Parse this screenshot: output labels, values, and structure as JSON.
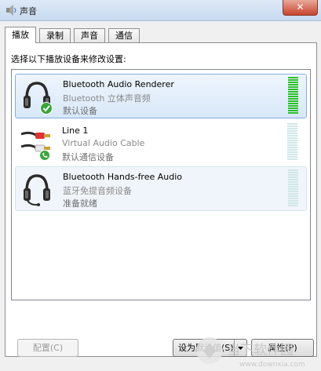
{
  "window": {
    "title": "声音",
    "close_symbol": "✕"
  },
  "tabs": [
    {
      "label": "播放",
      "active": true
    },
    {
      "label": "录制",
      "active": false
    },
    {
      "label": "声音",
      "active": false
    },
    {
      "label": "通信",
      "active": false
    }
  ],
  "instruction": "选择以下播放设备来修改设置:",
  "devices": [
    {
      "name": "Bluetooth Audio Renderer",
      "description": "Bluetooth 立体声音频",
      "status": "默认设备",
      "icon": "headphones-icon",
      "badge": "green-check",
      "state": "selected",
      "level": 1.0
    },
    {
      "name": "Line 1",
      "description": "Virtual Audio Cable",
      "status": "默认通信设备",
      "icon": "rca-cable-icon",
      "badge": "green-phone",
      "state": "normal",
      "level": 0
    },
    {
      "name": "Bluetooth Hands-free Audio",
      "description": "蓝牙免提音频设备",
      "status": "准备就绪",
      "icon": "headset-icon",
      "badge": "none",
      "state": "hover",
      "level": 0
    }
  ],
  "buttons": {
    "configure": "配置(C)",
    "set_default": "设为默认值(S)",
    "properties": "属性(P)"
  },
  "watermark": {
    "brand": "当下软件园",
    "url": "www.downxia.com"
  },
  "colors": {
    "meter_active": "#2fbf2f",
    "meter_inactive": "#cfe7e7",
    "selection_border": "#84acdd",
    "badge_green": "#3aa53a"
  }
}
